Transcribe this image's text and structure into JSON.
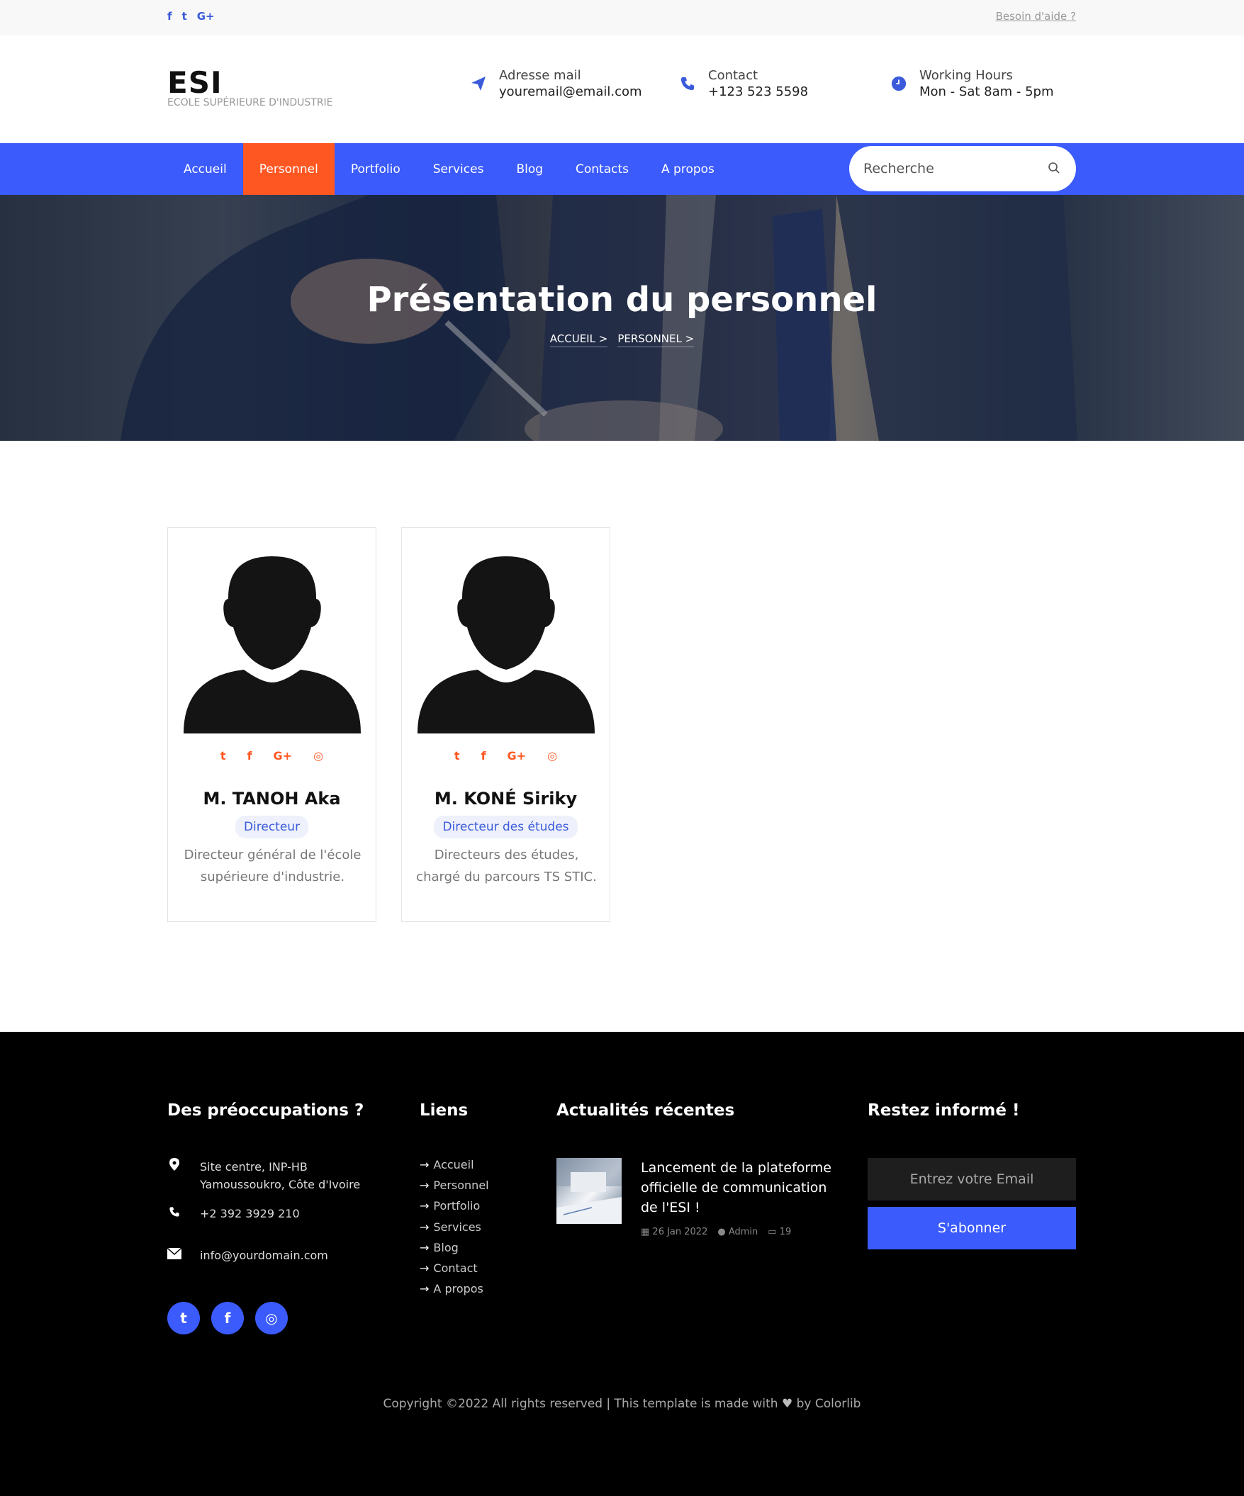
{
  "topbar": {
    "social_icons": [
      "facebook-icon",
      "twitter-icon",
      "google-plus-icon"
    ],
    "social_glyphs": [
      "f",
      "t",
      "G+"
    ],
    "help_link": "Besoin d'aide ?"
  },
  "header": {
    "brand_title": "ESI",
    "brand_subtitle": "ECOLE SUPÉRIEURE D'INDUSTRIE",
    "info": [
      {
        "icon": "paper-plane-icon",
        "label": "Adresse mail",
        "value": "youremail@email.com"
      },
      {
        "icon": "phone-icon",
        "label": "Contact",
        "value": "+123 523 5598"
      },
      {
        "icon": "clock-icon",
        "label": "Working Hours",
        "value": "Mon - Sat 8am - 5pm"
      }
    ]
  },
  "nav": {
    "items": [
      "Accueil",
      "Personnel",
      "Portfolio",
      "Services",
      "Blog",
      "Contacts",
      "A propos"
    ],
    "active": "Personnel",
    "search_placeholder": "Recherche"
  },
  "hero": {
    "title": "Présentation du personnel",
    "breadcrumb": [
      "ACCUEIL >",
      "PERSONNEL >"
    ]
  },
  "staff": [
    {
      "name": "M. TANOH Aka",
      "role": "Directeur",
      "description": "Directeur général de l'école supérieure d'industrie.",
      "socials": [
        "twitter-icon",
        "facebook-icon",
        "google-plus-icon",
        "instagram-icon"
      ]
    },
    {
      "name": "M. KONÉ Siriky",
      "role": "Directeur des études",
      "description": "Directeurs des études, chargé du parcours TS STIC.",
      "socials": [
        "twitter-icon",
        "facebook-icon",
        "google-plus-icon",
        "instagram-icon"
      ]
    }
  ],
  "footer": {
    "col1": {
      "heading": "Des préoccupations ?",
      "address_line1": "Site centre, INP-HB",
      "address_line2": "Yamoussoukro, Côte d'Ivoire",
      "phone": "+2 392 3929 210",
      "email": "info@yourdomain.com",
      "socials": [
        "twitter-icon",
        "facebook-icon",
        "instagram-icon"
      ]
    },
    "col2": {
      "heading": "Liens",
      "links": [
        "Accueil",
        "Personnel",
        "Portfolio",
        "Services",
        "Blog",
        "Contact",
        "A propos"
      ]
    },
    "col3": {
      "heading": "Actualités récentes",
      "post_title": "Lancement de la plateforme officielle de communication de l'ESI !",
      "post_date": "26 Jan 2022",
      "post_author": "Admin",
      "post_comments": "19"
    },
    "col4": {
      "heading": "Restez informé !",
      "email_placeholder": "Entrez votre Email",
      "subscribe_label": "S'abonner"
    },
    "copyright_before": "Copyright ©2022 All rights reserved | This template is made with",
    "copyright_after": "by Colorlib"
  },
  "colors": {
    "primary_blue": "#3b5bfd",
    "accent_orange": "#ff5722",
    "footer_bg": "#000000"
  }
}
